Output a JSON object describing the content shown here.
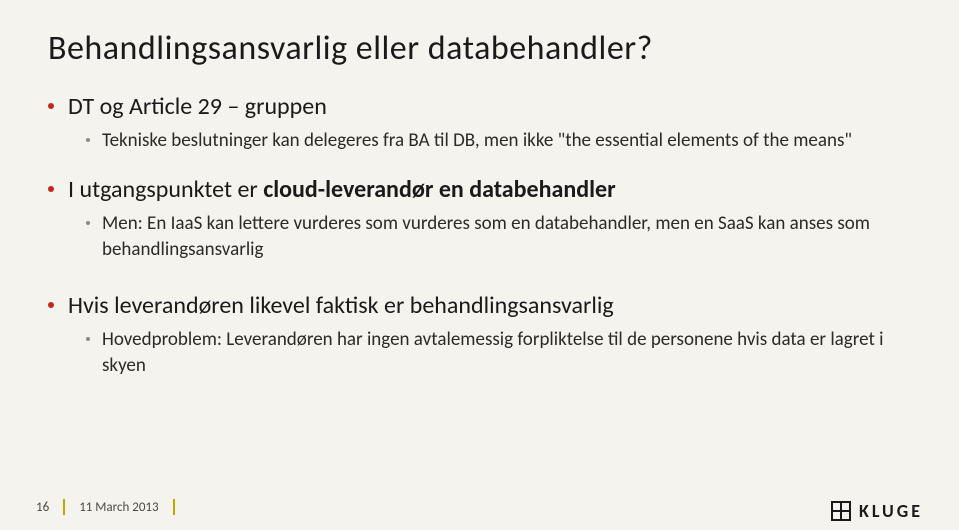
{
  "title": "Behandlingsansvarlig eller databehandler?",
  "bullets": [
    {
      "text": "DT og Article 29 – gruppen",
      "sub": [
        "Tekniske beslutninger kan delegeres fra BA til DB, men ikke \"the essential elements of the means\""
      ]
    },
    {
      "text_prefix": "I utgangspunktet er ",
      "text_bold": "cloud-leverandør en databehandler",
      "sub": [
        "Men: En IaaS kan lettere vurderes som vurderes som en databehandler, men en SaaS kan anses som behandlingsansvarlig"
      ]
    },
    {
      "text": "Hvis leverandøren likevel faktisk er behandlingsansvarlig",
      "sub": [
        "Hovedproblem: Leverandøren har ingen avtalemessig forpliktelse til de personene hvis data er lagret i skyen"
      ]
    }
  ],
  "footer": {
    "page": "16",
    "date": "11 March 2013"
  },
  "brand": "KLUGE"
}
